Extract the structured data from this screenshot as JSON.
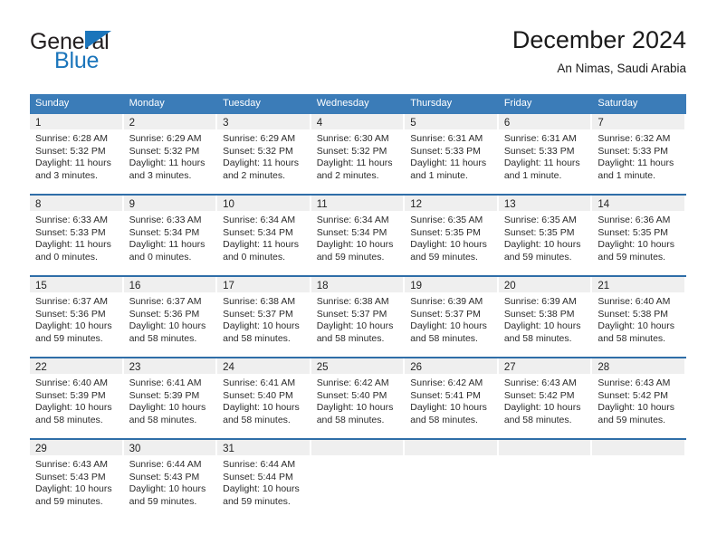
{
  "brand": {
    "name_top": "General",
    "name_bottom": "Blue",
    "triangle_color": "#1b75bb",
    "text_color": "#231f20"
  },
  "header": {
    "title": "December 2024",
    "subtitle": "An Nimas, Saudi Arabia"
  },
  "theme": {
    "header_blue": "#3b7cb8",
    "row_separator_blue": "#2f6ea8",
    "daynum_band": "#efefef",
    "text": "#2b2b2b"
  },
  "weekday_headers": [
    "Sunday",
    "Monday",
    "Tuesday",
    "Wednesday",
    "Thursday",
    "Friday",
    "Saturday"
  ],
  "labels": {
    "sunrise_prefix": "Sunrise:",
    "sunset_prefix": "Sunset:",
    "daylight_prefix": "Daylight:"
  },
  "weeks": [
    [
      {
        "day": "1",
        "sunrise": "Sunrise: 6:28 AM",
        "sunset": "Sunset: 5:32 PM",
        "daylight_1": "Daylight: 11 hours",
        "daylight_2": "and 3 minutes."
      },
      {
        "day": "2",
        "sunrise": "Sunrise: 6:29 AM",
        "sunset": "Sunset: 5:32 PM",
        "daylight_1": "Daylight: 11 hours",
        "daylight_2": "and 3 minutes."
      },
      {
        "day": "3",
        "sunrise": "Sunrise: 6:29 AM",
        "sunset": "Sunset: 5:32 PM",
        "daylight_1": "Daylight: 11 hours",
        "daylight_2": "and 2 minutes."
      },
      {
        "day": "4",
        "sunrise": "Sunrise: 6:30 AM",
        "sunset": "Sunset: 5:32 PM",
        "daylight_1": "Daylight: 11 hours",
        "daylight_2": "and 2 minutes."
      },
      {
        "day": "5",
        "sunrise": "Sunrise: 6:31 AM",
        "sunset": "Sunset: 5:33 PM",
        "daylight_1": "Daylight: 11 hours",
        "daylight_2": "and 1 minute."
      },
      {
        "day": "6",
        "sunrise": "Sunrise: 6:31 AM",
        "sunset": "Sunset: 5:33 PM",
        "daylight_1": "Daylight: 11 hours",
        "daylight_2": "and 1 minute."
      },
      {
        "day": "7",
        "sunrise": "Sunrise: 6:32 AM",
        "sunset": "Sunset: 5:33 PM",
        "daylight_1": "Daylight: 11 hours",
        "daylight_2": "and 1 minute."
      }
    ],
    [
      {
        "day": "8",
        "sunrise": "Sunrise: 6:33 AM",
        "sunset": "Sunset: 5:33 PM",
        "daylight_1": "Daylight: 11 hours",
        "daylight_2": "and 0 minutes."
      },
      {
        "day": "9",
        "sunrise": "Sunrise: 6:33 AM",
        "sunset": "Sunset: 5:34 PM",
        "daylight_1": "Daylight: 11 hours",
        "daylight_2": "and 0 minutes."
      },
      {
        "day": "10",
        "sunrise": "Sunrise: 6:34 AM",
        "sunset": "Sunset: 5:34 PM",
        "daylight_1": "Daylight: 11 hours",
        "daylight_2": "and 0 minutes."
      },
      {
        "day": "11",
        "sunrise": "Sunrise: 6:34 AM",
        "sunset": "Sunset: 5:34 PM",
        "daylight_1": "Daylight: 10 hours",
        "daylight_2": "and 59 minutes."
      },
      {
        "day": "12",
        "sunrise": "Sunrise: 6:35 AM",
        "sunset": "Sunset: 5:35 PM",
        "daylight_1": "Daylight: 10 hours",
        "daylight_2": "and 59 minutes."
      },
      {
        "day": "13",
        "sunrise": "Sunrise: 6:35 AM",
        "sunset": "Sunset: 5:35 PM",
        "daylight_1": "Daylight: 10 hours",
        "daylight_2": "and 59 minutes."
      },
      {
        "day": "14",
        "sunrise": "Sunrise: 6:36 AM",
        "sunset": "Sunset: 5:35 PM",
        "daylight_1": "Daylight: 10 hours",
        "daylight_2": "and 59 minutes."
      }
    ],
    [
      {
        "day": "15",
        "sunrise": "Sunrise: 6:37 AM",
        "sunset": "Sunset: 5:36 PM",
        "daylight_1": "Daylight: 10 hours",
        "daylight_2": "and 59 minutes."
      },
      {
        "day": "16",
        "sunrise": "Sunrise: 6:37 AM",
        "sunset": "Sunset: 5:36 PM",
        "daylight_1": "Daylight: 10 hours",
        "daylight_2": "and 58 minutes."
      },
      {
        "day": "17",
        "sunrise": "Sunrise: 6:38 AM",
        "sunset": "Sunset: 5:37 PM",
        "daylight_1": "Daylight: 10 hours",
        "daylight_2": "and 58 minutes."
      },
      {
        "day": "18",
        "sunrise": "Sunrise: 6:38 AM",
        "sunset": "Sunset: 5:37 PM",
        "daylight_1": "Daylight: 10 hours",
        "daylight_2": "and 58 minutes."
      },
      {
        "day": "19",
        "sunrise": "Sunrise: 6:39 AM",
        "sunset": "Sunset: 5:37 PM",
        "daylight_1": "Daylight: 10 hours",
        "daylight_2": "and 58 minutes."
      },
      {
        "day": "20",
        "sunrise": "Sunrise: 6:39 AM",
        "sunset": "Sunset: 5:38 PM",
        "daylight_1": "Daylight: 10 hours",
        "daylight_2": "and 58 minutes."
      },
      {
        "day": "21",
        "sunrise": "Sunrise: 6:40 AM",
        "sunset": "Sunset: 5:38 PM",
        "daylight_1": "Daylight: 10 hours",
        "daylight_2": "and 58 minutes."
      }
    ],
    [
      {
        "day": "22",
        "sunrise": "Sunrise: 6:40 AM",
        "sunset": "Sunset: 5:39 PM",
        "daylight_1": "Daylight: 10 hours",
        "daylight_2": "and 58 minutes."
      },
      {
        "day": "23",
        "sunrise": "Sunrise: 6:41 AM",
        "sunset": "Sunset: 5:39 PM",
        "daylight_1": "Daylight: 10 hours",
        "daylight_2": "and 58 minutes."
      },
      {
        "day": "24",
        "sunrise": "Sunrise: 6:41 AM",
        "sunset": "Sunset: 5:40 PM",
        "daylight_1": "Daylight: 10 hours",
        "daylight_2": "and 58 minutes."
      },
      {
        "day": "25",
        "sunrise": "Sunrise: 6:42 AM",
        "sunset": "Sunset: 5:40 PM",
        "daylight_1": "Daylight: 10 hours",
        "daylight_2": "and 58 minutes."
      },
      {
        "day": "26",
        "sunrise": "Sunrise: 6:42 AM",
        "sunset": "Sunset: 5:41 PM",
        "daylight_1": "Daylight: 10 hours",
        "daylight_2": "and 58 minutes."
      },
      {
        "day": "27",
        "sunrise": "Sunrise: 6:43 AM",
        "sunset": "Sunset: 5:42 PM",
        "daylight_1": "Daylight: 10 hours",
        "daylight_2": "and 58 minutes."
      },
      {
        "day": "28",
        "sunrise": "Sunrise: 6:43 AM",
        "sunset": "Sunset: 5:42 PM",
        "daylight_1": "Daylight: 10 hours",
        "daylight_2": "and 59 minutes."
      }
    ],
    [
      {
        "day": "29",
        "sunrise": "Sunrise: 6:43 AM",
        "sunset": "Sunset: 5:43 PM",
        "daylight_1": "Daylight: 10 hours",
        "daylight_2": "and 59 minutes."
      },
      {
        "day": "30",
        "sunrise": "Sunrise: 6:44 AM",
        "sunset": "Sunset: 5:43 PM",
        "daylight_1": "Daylight: 10 hours",
        "daylight_2": "and 59 minutes."
      },
      {
        "day": "31",
        "sunrise": "Sunrise: 6:44 AM",
        "sunset": "Sunset: 5:44 PM",
        "daylight_1": "Daylight: 10 hours",
        "daylight_2": "and 59 minutes."
      },
      {
        "day": "",
        "sunrise": "",
        "sunset": "",
        "daylight_1": "",
        "daylight_2": ""
      },
      {
        "day": "",
        "sunrise": "",
        "sunset": "",
        "daylight_1": "",
        "daylight_2": ""
      },
      {
        "day": "",
        "sunrise": "",
        "sunset": "",
        "daylight_1": "",
        "daylight_2": ""
      },
      {
        "day": "",
        "sunrise": "",
        "sunset": "",
        "daylight_1": "",
        "daylight_2": ""
      }
    ]
  ]
}
